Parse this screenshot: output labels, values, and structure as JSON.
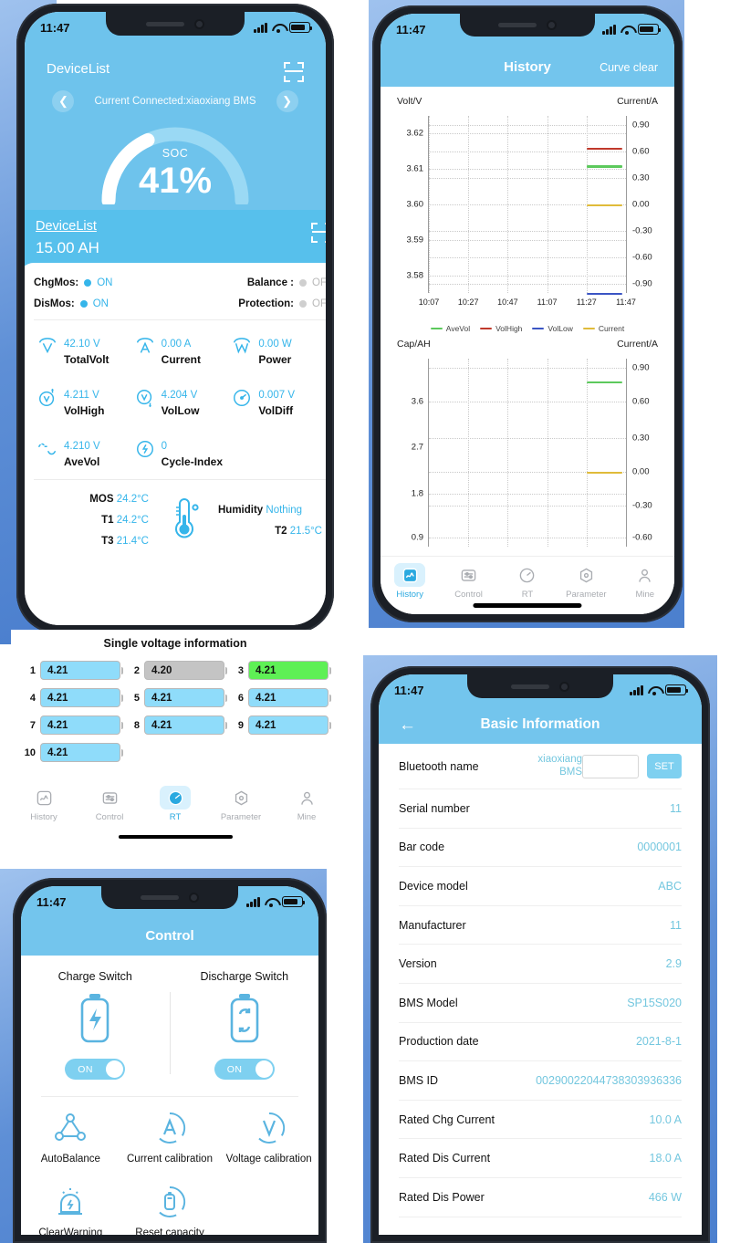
{
  "status_bar": {
    "time": "11:47"
  },
  "phone_rt": {
    "header": {
      "device_list": "DeviceList",
      "scan_icon": "scan-icon",
      "prev_icon": "chevron-left-icon",
      "next_icon": "chevron-right-icon",
      "connected": "Current Connected:xiaoxiang BMS"
    },
    "soc": {
      "label": "SOC",
      "value": "41%",
      "percent": 41
    },
    "overlay_header": {
      "device_list": "DeviceList",
      "capacity": "15.00 AH",
      "scan_icon": "scan-icon"
    },
    "mos": [
      {
        "label": "ChgMos:",
        "value": "ON",
        "state": "on"
      },
      {
        "label": "Balance :",
        "value": "OFF",
        "state": "off"
      },
      {
        "label": "DisMos:",
        "value": "ON",
        "state": "on"
      },
      {
        "label": "Protection:",
        "value": "OFF",
        "state": "off"
      }
    ],
    "metrics": [
      {
        "value": "42.10 V",
        "name": "TotalVolt",
        "icon": "volt-icon"
      },
      {
        "value": "0.00 A",
        "name": "Current",
        "icon": "ampere-icon"
      },
      {
        "value": "0.00 W",
        "name": "Power",
        "icon": "watt-icon"
      },
      {
        "value": "4.211 V",
        "name": "VolHigh",
        "icon": "volt-high-icon"
      },
      {
        "value": "4.204 V",
        "name": "VolLow",
        "icon": "volt-low-icon"
      },
      {
        "value": "0.007 V",
        "name": "VolDiff",
        "icon": "gauge-icon"
      },
      {
        "value": "4.210 V",
        "name": "AveVol",
        "icon": "wave-icon"
      },
      {
        "value": "0",
        "name": "Cycle-Index",
        "icon": "cycle-icon"
      }
    ],
    "temps": {
      "left": [
        {
          "k": "MOS",
          "v": "24.2°C"
        },
        {
          "k": "T1",
          "v": "24.2°C"
        },
        {
          "k": "T3",
          "v": "21.4°C"
        }
      ],
      "right": [
        {
          "k": "Humidity",
          "v": "Nothing"
        },
        {
          "k": "T2",
          "v": "21.5°C"
        }
      ],
      "thermometer_icon": "thermometer-icon"
    },
    "cells_title": "Single voltage information",
    "cells": [
      {
        "idx": "1",
        "v": "4.21",
        "state": "blue"
      },
      {
        "idx": "2",
        "v": "4.20",
        "state": "grey"
      },
      {
        "idx": "3",
        "v": "4.21",
        "state": "green"
      },
      {
        "idx": "4",
        "v": "4.21",
        "state": "blue"
      },
      {
        "idx": "5",
        "v": "4.21",
        "state": "blue"
      },
      {
        "idx": "6",
        "v": "4.21",
        "state": "blue"
      },
      {
        "idx": "7",
        "v": "4.21",
        "state": "blue"
      },
      {
        "idx": "8",
        "v": "4.21",
        "state": "blue"
      },
      {
        "idx": "9",
        "v": "4.21",
        "state": "blue"
      },
      {
        "idx": "10",
        "v": "4.21",
        "state": "blue"
      }
    ],
    "tabs": [
      {
        "label": "History",
        "icon": "chart-icon",
        "active": false
      },
      {
        "label": "Control",
        "icon": "sliders-icon",
        "active": false
      },
      {
        "label": "RT",
        "icon": "gauge-icon",
        "active": true
      },
      {
        "label": "Parameter",
        "icon": "hexagon-icon",
        "active": false
      },
      {
        "label": "Mine",
        "icon": "person-icon",
        "active": false
      }
    ]
  },
  "phone_history": {
    "header": {
      "title": "History",
      "clear": "Curve clear"
    },
    "tabs": [
      {
        "label": "History",
        "icon": "chart-icon",
        "active": true
      },
      {
        "label": "Control",
        "icon": "sliders-icon",
        "active": false
      },
      {
        "label": "RT",
        "icon": "gauge-icon",
        "active": false
      },
      {
        "label": "Parameter",
        "icon": "hexagon-icon",
        "active": false
      },
      {
        "label": "Mine",
        "icon": "person-icon",
        "active": false
      }
    ],
    "colors": {
      "avevol": "#5cc95c",
      "volhigh": "#c0392b",
      "vollow": "#3b55c4",
      "current": "#e0bb3a"
    }
  },
  "phone_control": {
    "header": {
      "title": "Control"
    },
    "switches": [
      {
        "name": "Charge Switch",
        "state": "ON",
        "icon": "battery-charge-icon"
      },
      {
        "name": "Discharge Switch",
        "state": "ON",
        "icon": "battery-discharge-icon"
      }
    ],
    "functions": [
      {
        "label": "AutoBalance",
        "icon": "balance-network-icon"
      },
      {
        "label": "Current calibration",
        "icon": "current-calibration-icon"
      },
      {
        "label": "Voltage calibration",
        "icon": "voltage-calibration-icon"
      },
      {
        "label": "ClearWarning",
        "icon": "clear-warning-icon"
      },
      {
        "label": "Reset capacity",
        "icon": "reset-capacity-icon"
      }
    ]
  },
  "phone_basic_info": {
    "header": {
      "title": "Basic Information",
      "back_icon": "back-arrow-icon"
    },
    "bluetooth": {
      "label": "Bluetooth name",
      "value": "xiaoxiang BMS",
      "input_value": "",
      "set_button": "SET"
    },
    "rows": [
      {
        "label": "Serial number",
        "value": "11"
      },
      {
        "label": "Bar code",
        "value": "0000001"
      },
      {
        "label": "Device model",
        "value": "ABC"
      },
      {
        "label": "Manufacturer",
        "value": "11"
      },
      {
        "label": "Version",
        "value": "2.9"
      },
      {
        "label": "BMS Model",
        "value": "SP15S020"
      },
      {
        "label": "Production date",
        "value": "2021-8-1"
      },
      {
        "label": "BMS ID",
        "value": "00290022044738303936336"
      },
      {
        "label": "Rated Chg Current",
        "value": "10.0 A"
      },
      {
        "label": "Rated Dis Current",
        "value": "18.0 A"
      },
      {
        "label": "Rated Dis Power",
        "value": "466 W"
      }
    ]
  },
  "chart_data": [
    {
      "type": "line",
      "title": "Volt/V",
      "ylabel": "Volt/V",
      "y2label": "Current/A",
      "xlabel": "",
      "x": [
        "10:07",
        "10:27",
        "10:47",
        "11:07",
        "11:27",
        "11:47"
      ],
      "yticks": [
        "3.62",
        "3.61",
        "3.60",
        "3.59",
        "3.58"
      ],
      "ylim": [
        3.575,
        3.625
      ],
      "y2ticks": [
        "0.90",
        "0.60",
        "0.30",
        "0.00",
        "-0.30",
        "-0.60",
        "-0.90"
      ],
      "y2lim": [
        -1.05,
        1.05
      ],
      "grid": true,
      "legend_position": "bottom",
      "series": [
        {
          "name": "AveVol",
          "color": "#5cc95c",
          "x": [
            "11:27",
            "11:47"
          ],
          "values": [
            3.61,
            3.61
          ]
        },
        {
          "name": "VolHigh",
          "color": "#c0392b",
          "x": [
            "11:27",
            "11:47"
          ],
          "values": [
            3.6165,
            3.6165
          ]
        },
        {
          "name": "VolLow",
          "color": "#3b55c4",
          "x": [
            "11:27",
            "11:47"
          ],
          "values": [
            3.5755,
            3.5755
          ]
        },
        {
          "name": "Current",
          "color": "#e0bb3a",
          "x": [
            "11:27",
            "11:47"
          ],
          "values": [
            3.5975,
            3.5975
          ]
        }
      ]
    },
    {
      "type": "line",
      "title": "Cap/AH",
      "ylabel": "Cap/AH",
      "y2label": "Current/A",
      "xlabel": "",
      "x": [
        "10:07",
        "10:27",
        "10:47",
        "11:07",
        "11:27",
        "11:47"
      ],
      "yticks": [
        "3.6",
        "2.7",
        "1.8",
        "0.9"
      ],
      "ylim": [
        0.6,
        4.5
      ],
      "y2ticks": [
        "0.90",
        "0.60",
        "0.30",
        "0.00",
        "-0.30",
        "-0.60"
      ],
      "y2lim": [
        -0.75,
        1.05
      ],
      "grid": true,
      "legend_position": "none",
      "series": [
        {
          "name": "Cap",
          "color": "#5cc95c",
          "x": [
            "11:27",
            "11:47"
          ],
          "values": [
            4.05,
            4.05
          ]
        },
        {
          "name": "Current",
          "color": "#e0bb3a",
          "x": [
            "11:27",
            "11:47"
          ],
          "values": [
            2.25,
            2.25
          ]
        }
      ]
    }
  ]
}
